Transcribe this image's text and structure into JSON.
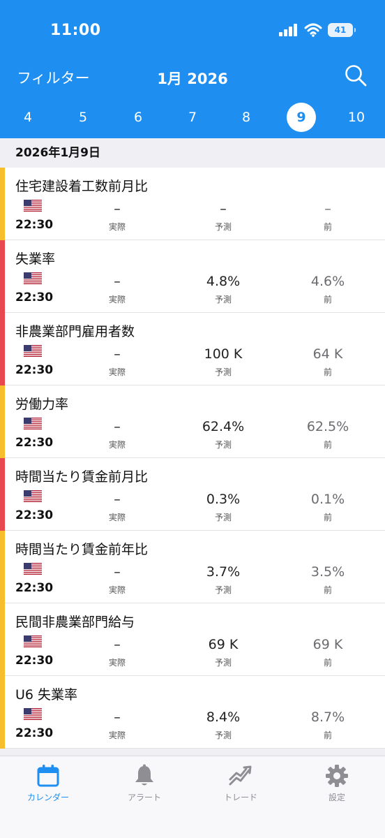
{
  "status_bar": {
    "time": "11:00",
    "battery": "41"
  },
  "header": {
    "filter_label": "フィルター",
    "month_title": "1月 2026"
  },
  "date_strip": {
    "days": [
      "4",
      "5",
      "6",
      "7",
      "8",
      "9",
      "10"
    ],
    "selected": "9"
  },
  "list": {
    "date_header": "2026年1月9日"
  },
  "colors": {
    "accent": "#1f8ef1",
    "medium_impact": "#f5be2a",
    "high_impact": "#e8484e"
  },
  "column_labels": {
    "actual": "実際",
    "forecast": "予測",
    "previous": "前"
  },
  "events": [
    {
      "title": "住宅建設着工数前月比",
      "time": "22:30",
      "actual": "–",
      "forecast": "–",
      "previous": "–",
      "impact": "medium"
    },
    {
      "title": "失業率",
      "time": "22:30",
      "actual": "–",
      "forecast": "4.8%",
      "previous": "4.6%",
      "impact": "high"
    },
    {
      "title": "非農業部門雇用者数",
      "time": "22:30",
      "actual": "–",
      "forecast": "100 K",
      "previous": "64 K",
      "impact": "high"
    },
    {
      "title": "労働力率",
      "time": "22:30",
      "actual": "–",
      "forecast": "62.4%",
      "previous": "62.5%",
      "impact": "medium"
    },
    {
      "title": "時間当たり賃金前月比",
      "time": "22:30",
      "actual": "–",
      "forecast": "0.3%",
      "previous": "0.1%",
      "impact": "high"
    },
    {
      "title": "時間当たり賃金前年比",
      "time": "22:30",
      "actual": "–",
      "forecast": "3.7%",
      "previous": "3.5%",
      "impact": "medium"
    },
    {
      "title": "民間非農業部門給与",
      "time": "22:30",
      "actual": "–",
      "forecast": "69 K",
      "previous": "69 K",
      "impact": "medium"
    },
    {
      "title": "U6 失業率",
      "time": "22:30",
      "actual": "–",
      "forecast": "8.4%",
      "previous": "8.7%",
      "impact": "medium"
    }
  ],
  "tabs": [
    {
      "label": "カレンダー",
      "icon": "calendar-icon",
      "active": true
    },
    {
      "label": "アラート",
      "icon": "bell-icon",
      "active": false
    },
    {
      "label": "トレード",
      "icon": "trade-chart-icon",
      "active": false
    },
    {
      "label": "設定",
      "icon": "gear-icon",
      "active": false
    }
  ]
}
